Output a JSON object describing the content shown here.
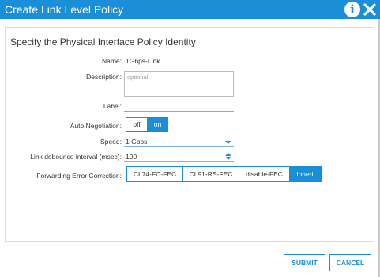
{
  "dialog": {
    "title": "Create Link Level Policy",
    "section_heading": "Specify the Physical Interface Policy Identity"
  },
  "form": {
    "name": {
      "label": "Name:",
      "value": "1Gbps-Link"
    },
    "description": {
      "label": "Description:",
      "placeholder": "optional"
    },
    "label_field": {
      "label": "Label:",
      "value": ""
    },
    "auto_negotiation": {
      "label": "Auto Negotiation:",
      "options": [
        "off",
        "on"
      ],
      "selected": "on"
    },
    "speed": {
      "label": "Speed:",
      "value": "1 Gbps"
    },
    "debounce": {
      "label": "Link debounce interval (msec):",
      "value": "100"
    },
    "fec": {
      "label": "Forwarding Error Correction:",
      "options": [
        "CL74-FC-FEC",
        "CL91-RS-FEC",
        "disable-FEC",
        "Inherit"
      ],
      "selected": "Inherit"
    }
  },
  "footer": {
    "submit_label": "SUBMIT",
    "cancel_label": "CANCEL"
  },
  "colors": {
    "accent": "#1a8fd8",
    "title_bar": "#1a8fd8"
  },
  "icons": {
    "info": "info-icon",
    "close": "close-icon"
  }
}
